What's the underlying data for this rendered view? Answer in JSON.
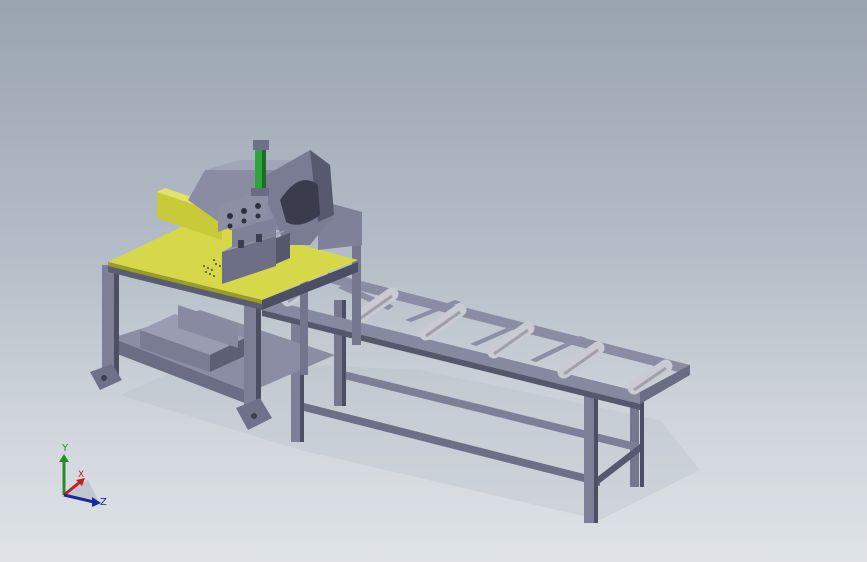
{
  "viewport": {
    "background_top": "#9aa4b0",
    "background_bottom": "#dfe3e7"
  },
  "model": {
    "frame_color": "#7d7f97",
    "frame_dark": "#4c4e63",
    "table_color": "#d4d64a",
    "cylinder_color": "#2fa43a",
    "roller_color": "#d5d6db"
  },
  "triad": {
    "y_label": "Y",
    "x_label": "X",
    "z_label": "Z",
    "y_color": "#2a8a2a",
    "x_color": "#c02020",
    "z_color": "#1a2a9a"
  }
}
